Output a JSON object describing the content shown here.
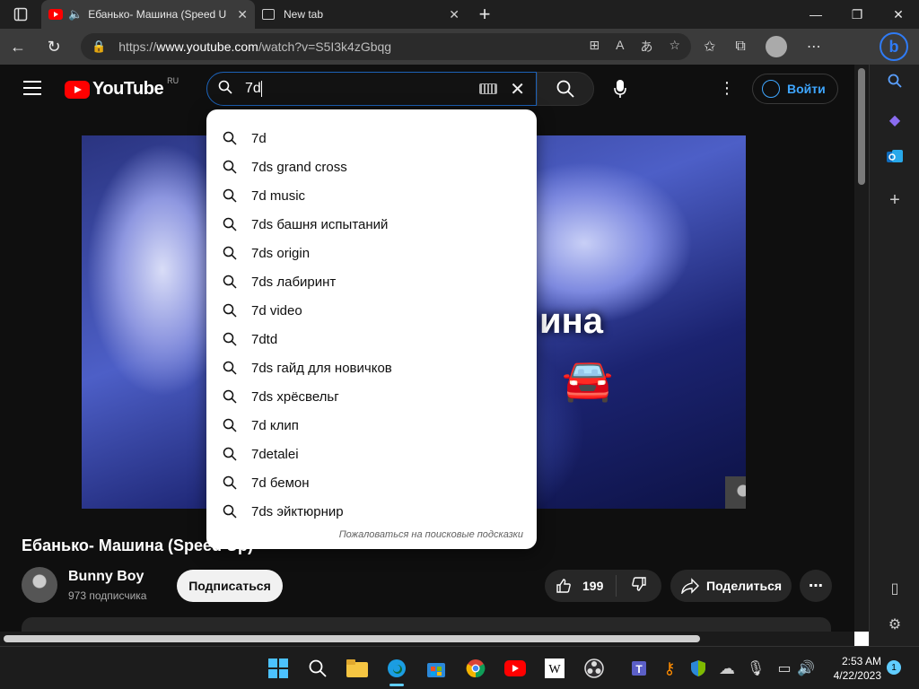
{
  "browser": {
    "tabs": [
      {
        "title": "Ебанько- Машина (Speed U",
        "active": true
      },
      {
        "title": "New tab",
        "active": false
      }
    ],
    "url_prefix": "https://",
    "url_domain": "www.youtube.com",
    "url_path": "/watch?v=S5I3k4zGbqg"
  },
  "youtube": {
    "logo_text": "YouTube",
    "region": "RU",
    "search_query": "7d",
    "signin_label": "Войти",
    "suggestions": [
      "7d",
      "7ds grand cross",
      "7d music",
      "7ds башня испытаний",
      "7ds origin",
      "7ds лабиринт",
      "7d video",
      "7dtd",
      "7ds гайд для новичков",
      "7ds хрёсвельг",
      "7d клип",
      "7detalei",
      "7d бемон",
      "7ds эйктюрнир"
    ],
    "report_link": "Пожаловаться на поисковые подсказки",
    "video_overlay_text": "ина",
    "video_title": "Ебанько- Машина (Speed Up)",
    "channel_name": "Bunny Boy",
    "subscribers": "973 подписчика",
    "subscribe_label": "Подписаться",
    "like_count": "199",
    "share_label": "Поделиться"
  },
  "taskbar": {
    "time": "2:53 AM",
    "date": "4/22/2023",
    "notifications": "1"
  },
  "colors": {
    "accent_blue": "#3ea6ff",
    "youtube_red": "#ff0000",
    "search_focus": "#1c62b9"
  }
}
